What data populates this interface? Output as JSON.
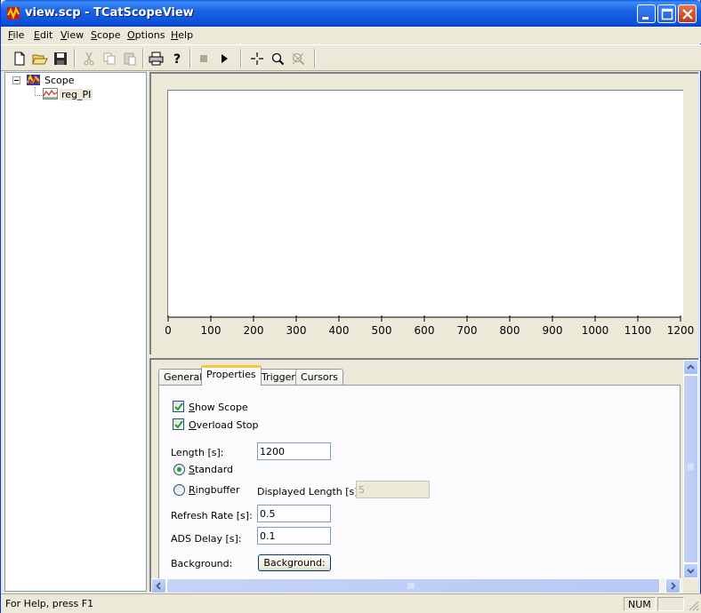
{
  "window": {
    "title": "view.scp - TCatScopeView"
  },
  "menu": [
    {
      "label": "File",
      "key": "F",
      "rest": "ile"
    },
    {
      "label": "Edit",
      "key": "E",
      "rest": "dit"
    },
    {
      "label": "View",
      "key": "V",
      "rest": "iew"
    },
    {
      "label": "Scope",
      "key": "S",
      "rest": "cope"
    },
    {
      "label": "Options",
      "key": "O",
      "rest": "ptions"
    },
    {
      "label": "Help",
      "key": "H",
      "rest": "elp"
    }
  ],
  "toolbar": {
    "icons": [
      "new-file-icon",
      "open-folder-icon",
      "save-disk-icon",
      "cut-icon",
      "copy-icon",
      "paste-icon",
      "print-icon",
      "help-icon",
      "stop-icon",
      "play-icon",
      "crosshair-icon",
      "zoom-icon",
      "zoom-off-icon"
    ]
  },
  "tree": {
    "root": "Scope",
    "child": "reg_PI"
  },
  "chart_data": {
    "type": "line",
    "series": [],
    "xlim": [
      0,
      1200
    ],
    "x_ticks": [
      "0",
      "100",
      "200",
      "300",
      "400",
      "500",
      "600",
      "700",
      "800",
      "900",
      "1000",
      "1100",
      "1200"
    ],
    "grid": false
  },
  "tabs": [
    {
      "label": "General",
      "active": false
    },
    {
      "label": "Properties",
      "active": true
    },
    {
      "label": "Trigger",
      "active": false
    },
    {
      "label": "Cursors",
      "active": false
    }
  ],
  "properties": {
    "show_scope": {
      "key": "S",
      "rest": "how Scope",
      "checked": true
    },
    "overload_stop": {
      "key": "O",
      "rest": "verload Stop",
      "checked": true
    },
    "length_label": "Length [s]:",
    "length_value": "1200",
    "standard": {
      "key": "S",
      "rest": "tandard",
      "selected": true
    },
    "ringbuffer": {
      "key": "R",
      "rest": "ingbuffer",
      "selected": false
    },
    "displayed_length_label": "Displayed Length [s]:",
    "displayed_length_value": "5",
    "refresh_rate_label": "Refresh Rate [s]:",
    "refresh_rate_value": "0.5",
    "ads_delay_label": "ADS Delay [s]:",
    "ads_delay_value": "0.1",
    "background_label": "Background:",
    "background_button": "Background:"
  },
  "status": {
    "help_text": "For Help, press F1",
    "num": "NUM"
  },
  "colors": {
    "titlebar": "#0b50d8",
    "face": "#ece9d8",
    "tab_highlight": "#ffc83c"
  }
}
